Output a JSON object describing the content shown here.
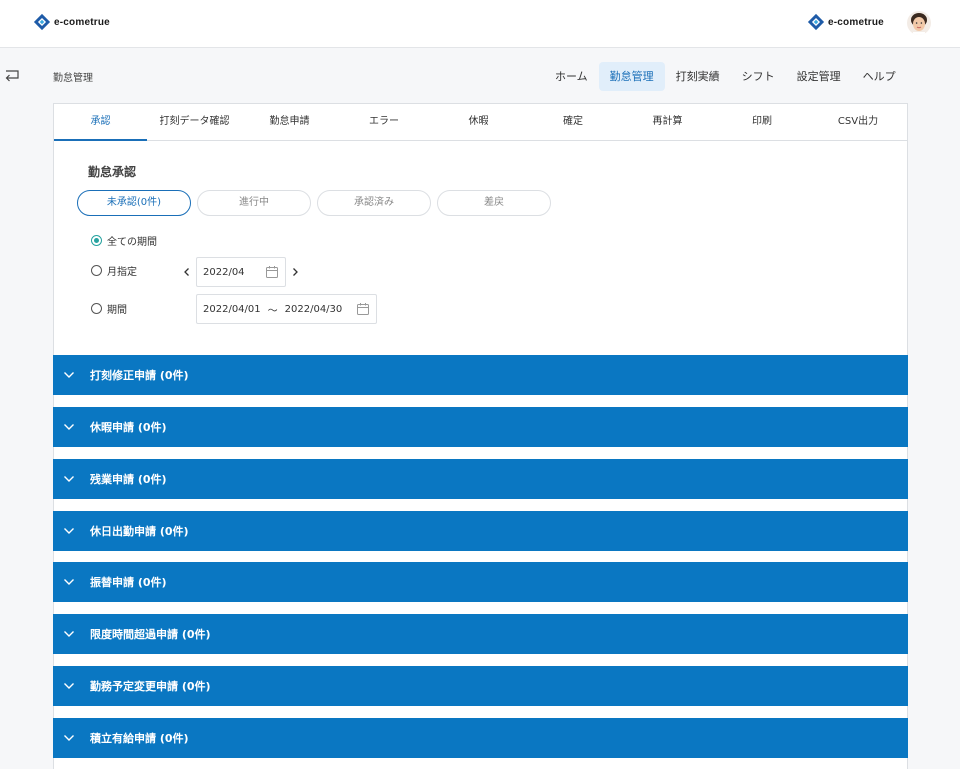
{
  "header": {
    "brand_left": "e-cometrue",
    "brand_right": "e-cometrue"
  },
  "page": {
    "title": "勤怠管理"
  },
  "mainnav": [
    {
      "label": "ホーム"
    },
    {
      "label": "勤怠管理"
    },
    {
      "label": "打刻実績"
    },
    {
      "label": "シフト"
    },
    {
      "label": "設定管理"
    },
    {
      "label": "ヘルプ"
    }
  ],
  "subtabs": [
    {
      "label": "承認"
    },
    {
      "label": "打刻データ確認"
    },
    {
      "label": "勤怠申請"
    },
    {
      "label": "エラー"
    },
    {
      "label": "休暇"
    },
    {
      "label": "確定"
    },
    {
      "label": "再計算"
    },
    {
      "label": "印刷"
    },
    {
      "label": "CSV出力"
    }
  ],
  "approval": {
    "title": "勤怠承認",
    "status_filters": [
      {
        "label": "未承認(0件)"
      },
      {
        "label": "進行中"
      },
      {
        "label": "承認済み"
      },
      {
        "label": "差戻"
      }
    ],
    "period": {
      "all_label": "全ての期間",
      "month_label": "月指定",
      "range_label": "期間",
      "month_value": "2022/04",
      "range_start": "2022/04/01",
      "range_sep": "〜",
      "range_end": "2022/04/30"
    }
  },
  "accordions": [
    {
      "label": "打刻修正申請 (0件)"
    },
    {
      "label": "休暇申請 (0件)"
    },
    {
      "label": "残業申請 (0件)"
    },
    {
      "label": "休日出勤申請 (0件)"
    },
    {
      "label": "振替申請 (0件)"
    },
    {
      "label": "限度時間超過申請 (0件)"
    },
    {
      "label": "勤務予定変更申請 (0件)"
    },
    {
      "label": "積立有給申請 (0件)"
    }
  ],
  "colors": {
    "accent": "#1a6fb8",
    "accordion_bg": "#0a77c2",
    "radio_checked": "#27a3a0"
  }
}
